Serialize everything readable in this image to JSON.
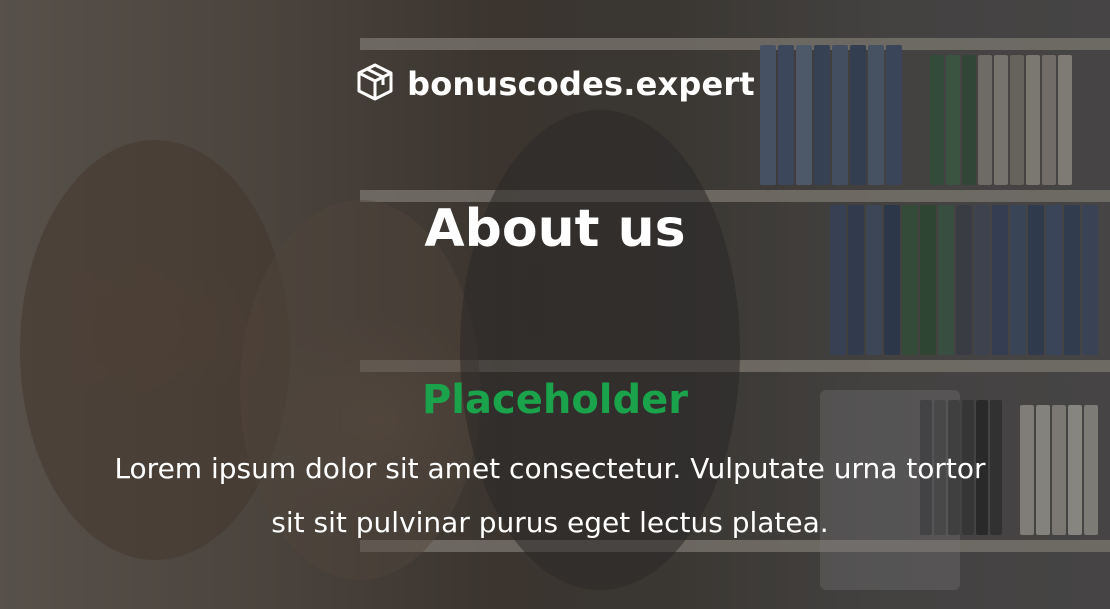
{
  "logo": {
    "text": "bonuscodes.expert",
    "icon": "box-icon"
  },
  "hero": {
    "title": "About us",
    "subtitle": "Placeholder",
    "description": "Lorem ipsum dolor sit amet consectetur. Vulputate urna tortor sit sit pulvinar purus eget lectus platea."
  },
  "colors": {
    "accent": "#1aa34a",
    "text": "#ffffff"
  }
}
